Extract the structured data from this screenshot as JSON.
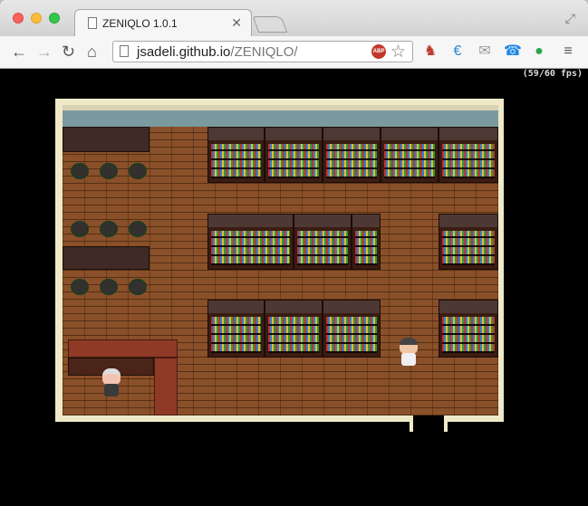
{
  "browser": {
    "tab_title": "ZENIQLO 1.0.1",
    "url_host": "jsadeli.github.io",
    "url_path": "/ZENIQLO/",
    "abp_label": "ABP"
  },
  "toolbar_icons": [
    "back-icon",
    "forward-icon",
    "reload-icon",
    "home-icon",
    "bookmark-star-icon",
    "extension-chair-icon",
    "extension-e-icon",
    "extension-mail-icon",
    "extension-phone-icon",
    "extension-leaf-icon",
    "menu-icon"
  ],
  "game": {
    "fps_label": "(59/60 fps)",
    "player_name": "",
    "colors": {
      "floor": "#8a5029",
      "wall": "#7a9aa0",
      "frame": "#efe9c8",
      "counter": "#8e3a26"
    }
  }
}
